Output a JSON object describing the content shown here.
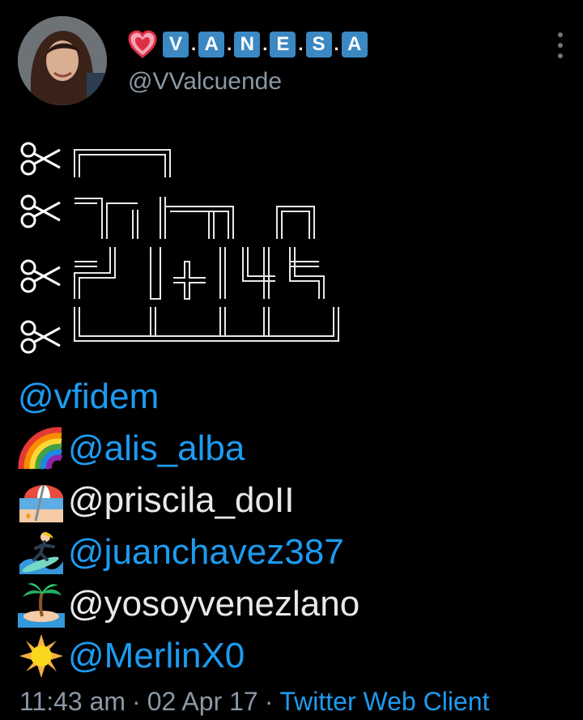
{
  "header": {
    "avatar_icon": "profile-avatar",
    "heart_icon": "heart-emoji",
    "name_letters": [
      "V",
      "A",
      "N",
      "E",
      "S",
      "A"
    ],
    "name_separator": ".",
    "handle": "@VValcuende",
    "more_icon": "vertical-ellipsis-icon"
  },
  "ascii_art": {
    "scissors_icon": "scissors-icon"
  },
  "mentions": [
    {
      "emoji": "",
      "handle": "@vfidem",
      "linked": true
    },
    {
      "emoji": "rainbow",
      "handle": "@alis_alba",
      "linked": true
    },
    {
      "emoji": "beach-umbrella",
      "handle": "@priscila_doII",
      "linked": false
    },
    {
      "emoji": "woman-surfing",
      "handle": "@juanchavez387",
      "linked": true
    },
    {
      "emoji": "desert-island",
      "handle": "@yosoyvenezlano",
      "linked": false
    },
    {
      "emoji": "sun",
      "handle": "@MerlinX0",
      "linked": true
    }
  ],
  "footer": {
    "time": "11:43 am",
    "separator": "·",
    "date": "02 Apr 17",
    "client": "Twitter Web Client"
  },
  "colors": {
    "background": "#000000",
    "link": "#1d9bf0",
    "muted": "#8b98a5",
    "letter_box": "#3b88c3"
  }
}
